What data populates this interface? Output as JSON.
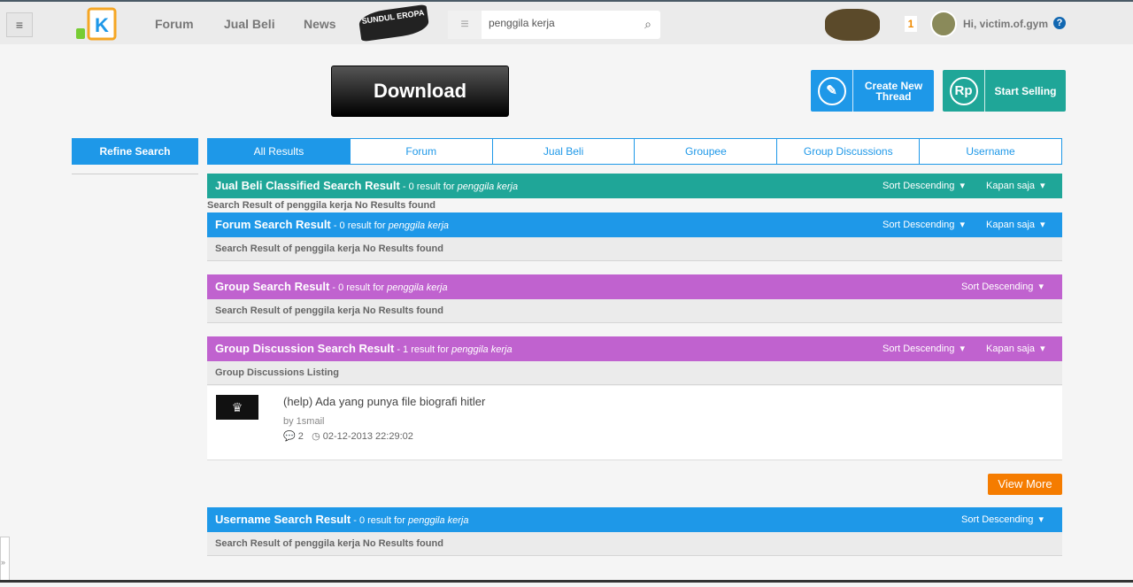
{
  "header": {
    "menu_icon": "hamburger-icon",
    "nav": [
      "Forum",
      "Jual Beli",
      "News"
    ],
    "sundul_logo": "SUNDUL EROPA",
    "search_value": "penggila kerja",
    "notif_count": "1",
    "greeting": "Hi, victim.of.gym",
    "help": "?"
  },
  "actions": {
    "download": "Download",
    "create_thread": "Create New Thread",
    "start_selling": "Start Selling",
    "rp": "Rp"
  },
  "sidebar": {
    "refine": "Refine Search"
  },
  "tabs": [
    "All Results",
    "Forum",
    "Jual Beli",
    "Groupee",
    "Group Discussions",
    "Username"
  ],
  "colors": {
    "blue": "#1e98e8",
    "teal": "#1fa698",
    "purple": "#c062cf",
    "orange": "#f57c00"
  },
  "sections": {
    "jual": {
      "title": "Jual Beli Classified Search Result",
      "count": " - 0 result for ",
      "query": "penggila kerja",
      "sort": "Sort Descending",
      "time": "Kapan saja",
      "body": "Search Result of penggila kerja No Results found"
    },
    "forum": {
      "title": "Forum Search Result",
      "count": " - 0 result for ",
      "query": "penggila kerja",
      "sort": "Sort Descending",
      "time": "Kapan saja",
      "body": "Search Result of penggila kerja No Results found"
    },
    "group": {
      "title": "Group Search Result",
      "count": " - 0 result for ",
      "query": "penggila kerja",
      "sort": "Sort Descending",
      "body": "Search Result of penggila kerja No Results found"
    },
    "gd": {
      "title": "Group Discussion Search Result",
      "count": " - 1 result for ",
      "query": "penggila kerja",
      "sort": "Sort Descending",
      "time": "Kapan saja",
      "body": "Group Discussions Listing",
      "item": {
        "title": "(help) Ada yang punya file biografi hitler",
        "by": "by 1smail",
        "comments": "2",
        "date": "02-12-2013 22:29:02"
      },
      "view_more": "View More"
    },
    "user": {
      "title": "Username Search Result",
      "count": " - 0 result for ",
      "query": "penggila kerja",
      "sort": "Sort Descending",
      "body": "Search Result of penggila kerja No Results found"
    }
  }
}
